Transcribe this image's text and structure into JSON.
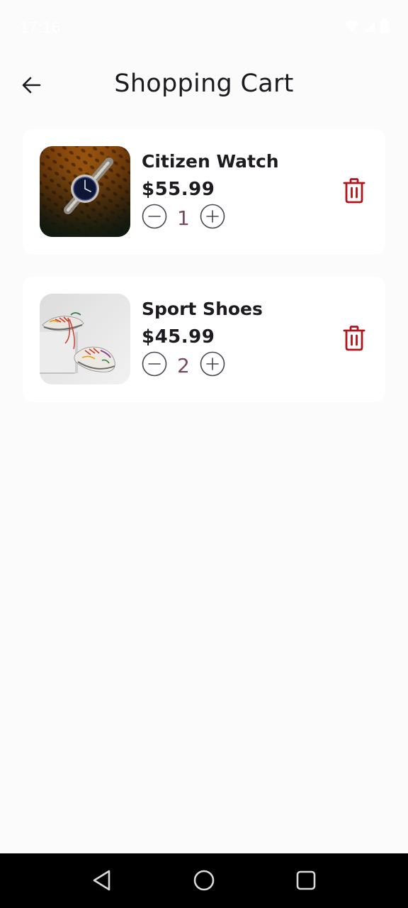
{
  "status_bar": {
    "time": "17:16",
    "icons": [
      "gallery-icon",
      "wifi-icon",
      "signal-icon",
      "battery-icon"
    ]
  },
  "app_bar": {
    "title": "Shopping Cart",
    "back_icon": "arrow-left-icon"
  },
  "cart": {
    "items": [
      {
        "name": "Citizen Watch",
        "price": "$55.99",
        "quantity": "1",
        "image": "watch-photo"
      },
      {
        "name": "Sport Shoes",
        "price": "$45.99",
        "quantity": "2",
        "image": "sneakers-photo"
      }
    ]
  },
  "nav_bar": {
    "icons": [
      "back-triangle-icon",
      "home-circle-icon",
      "recents-square-icon"
    ]
  },
  "colors": {
    "background": "#fbfbfb",
    "card": "#ffffff",
    "delete": "#b3141c",
    "quantity_text": "#7a4a5c"
  }
}
